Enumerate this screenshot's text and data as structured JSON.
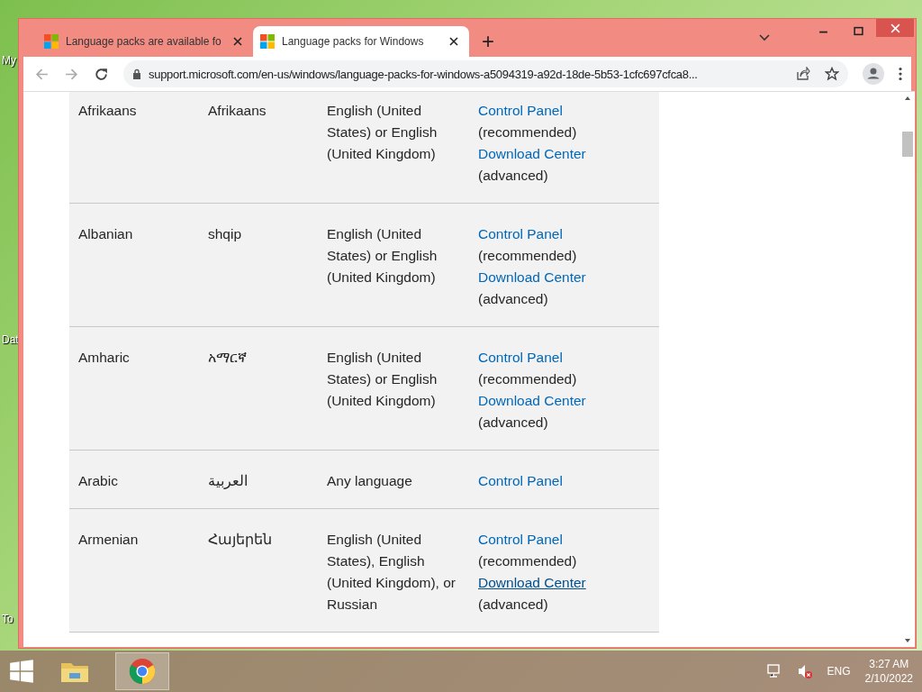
{
  "desktop": {
    "icon_labels": [
      "My",
      "Dat",
      "To"
    ]
  },
  "browser": {
    "tabs": [
      {
        "title": "Language packs are available fo",
        "selected": false
      },
      {
        "title": "Language packs for Windows",
        "selected": true
      }
    ],
    "new_tab": "+",
    "address": "support.microsoft.com/en-us/windows/language-packs-for-windows-a5094319-a92d-18de-5b53-1cfc697cfca8..."
  },
  "table": {
    "rows": [
      {
        "language": "Afrikaans",
        "native": "Afrikaans",
        "base": "English (United States) or English (United Kingdom)",
        "how": [
          {
            "kind": "link",
            "text": "Control Panel",
            "underlined": false
          },
          {
            "kind": "note",
            "text": "(recommended)"
          },
          {
            "kind": "link",
            "text": "Download Center",
            "underlined": false
          },
          {
            "kind": "note",
            "text": "(advanced)"
          }
        ]
      },
      {
        "language": "Albanian",
        "native": "shqip",
        "base": "English (United States) or English (United Kingdom)",
        "how": [
          {
            "kind": "link",
            "text": "Control Panel",
            "underlined": false
          },
          {
            "kind": "note",
            "text": "(recommended)"
          },
          {
            "kind": "link",
            "text": "Download Center",
            "underlined": false
          },
          {
            "kind": "note",
            "text": "(advanced)"
          }
        ]
      },
      {
        "language": "Amharic",
        "native": "አማርኛ",
        "base": "English (United States) or English (United Kingdom)",
        "how": [
          {
            "kind": "link",
            "text": "Control Panel",
            "underlined": false
          },
          {
            "kind": "note",
            "text": "(recommended)"
          },
          {
            "kind": "link",
            "text": "Download Center",
            "underlined": false
          },
          {
            "kind": "note",
            "text": "(advanced)"
          }
        ]
      },
      {
        "language": "Arabic",
        "native": "العربية",
        "base": "Any language",
        "how": [
          {
            "kind": "link",
            "text": "Control Panel",
            "underlined": false
          }
        ]
      },
      {
        "language": "Armenian",
        "native": "Հայերեն",
        "base": "English (United States), English (United Kingdom), or Russian",
        "how": [
          {
            "kind": "link",
            "text": "Control Panel",
            "underlined": false
          },
          {
            "kind": "note",
            "text": "(recommended)"
          },
          {
            "kind": "link",
            "text": "Download Center",
            "underlined": true
          },
          {
            "kind": "note",
            "text": "(advanced)"
          }
        ]
      }
    ]
  },
  "taskbar": {
    "language": "ENG",
    "time": "3:27 AM",
    "date": "2/10/2022"
  }
}
